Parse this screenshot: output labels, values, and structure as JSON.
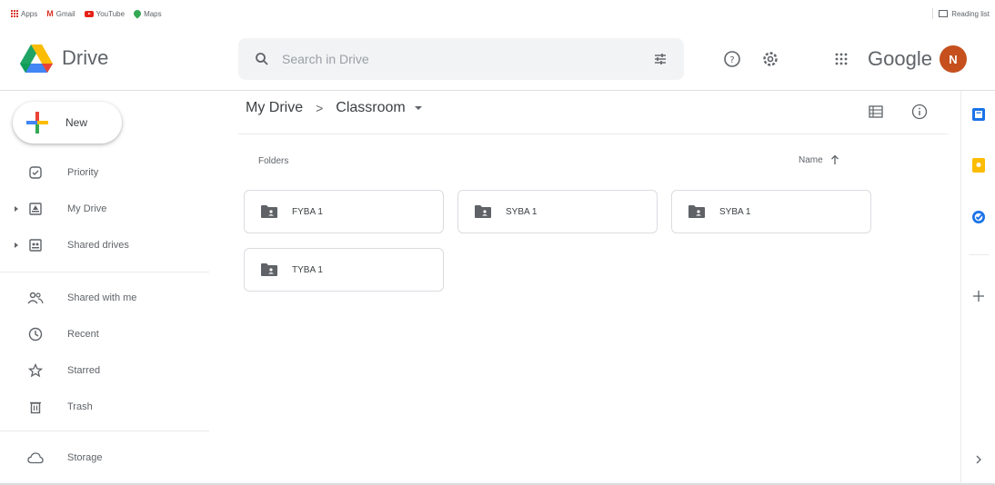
{
  "bookmarks": [
    {
      "label": "Apps",
      "icon": "apps-grid-icon"
    },
    {
      "label": "Gmail",
      "icon": "gmail-icon"
    },
    {
      "label": "YouTube",
      "icon": "youtube-icon"
    },
    {
      "label": "Maps",
      "icon": "maps-icon"
    }
  ],
  "reading_list": "Reading list",
  "header": {
    "app_name": "Drive",
    "search_placeholder": "Search in Drive",
    "google_label": "Google",
    "avatar_initial": "N"
  },
  "sidebar": {
    "new_label": "New",
    "items": [
      {
        "label": "Priority",
        "icon": "priority-icon",
        "expandable": false
      },
      {
        "label": "My Drive",
        "icon": "my-drive-icon",
        "expandable": true
      },
      {
        "label": "Shared drives",
        "icon": "shared-drives-icon",
        "expandable": true
      },
      {
        "label": "Shared with me",
        "icon": "shared-with-me-icon",
        "expandable": false
      },
      {
        "label": "Recent",
        "icon": "clock-icon",
        "expandable": false
      },
      {
        "label": "Starred",
        "icon": "star-icon",
        "expandable": false
      },
      {
        "label": "Trash",
        "icon": "trash-icon",
        "expandable": false
      },
      {
        "label": "Storage",
        "icon": "cloud-icon",
        "expandable": false
      }
    ]
  },
  "breadcrumb": {
    "root": "My Drive",
    "separator": ">",
    "current": "Classroom"
  },
  "content": {
    "folders_heading": "Folders",
    "sort_label": "Name",
    "folders": [
      "FYBA 1",
      "SYBA 1",
      "SYBA 1",
      "TYBA 1"
    ]
  },
  "colors": {
    "accent_blue": "#1a73e8",
    "avatar_bg": "#c5501e",
    "keep_yellow": "#fbbc04"
  }
}
